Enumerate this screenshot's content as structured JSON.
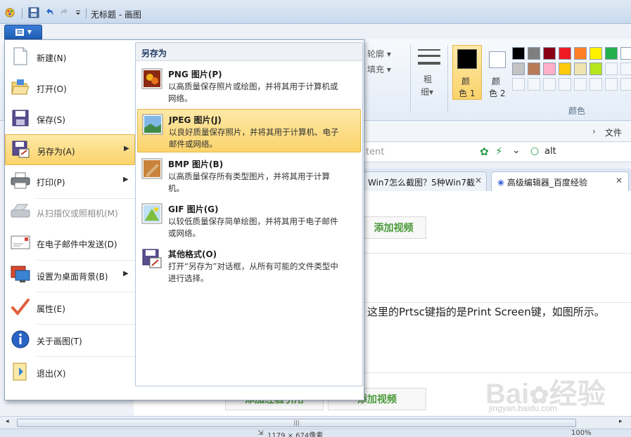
{
  "window": {
    "title": "无标题 - 画图"
  },
  "app_menu": {
    "items": [
      {
        "label": "新建(N)",
        "icon": "new-file-icon",
        "submenu": false,
        "disabled": false
      },
      {
        "label": "打开(O)",
        "icon": "open-folder-icon",
        "submenu": false,
        "disabled": false
      },
      {
        "label": "保存(S)",
        "icon": "save-disk-icon",
        "submenu": false,
        "disabled": false
      },
      {
        "label": "另存为(A)",
        "icon": "save-as-icon",
        "submenu": true,
        "disabled": false,
        "highlighted": true
      },
      {
        "label": "打印(P)",
        "icon": "printer-icon",
        "submenu": true,
        "disabled": false
      },
      {
        "label": "从扫描仪或照相机(M)",
        "icon": "scanner-icon",
        "submenu": false,
        "disabled": true
      },
      {
        "label": "在电子邮件中发送(D)",
        "icon": "email-icon",
        "submenu": false,
        "disabled": false
      },
      {
        "label": "设置为桌面背景(B)",
        "icon": "desktop-background-icon",
        "submenu": true,
        "disabled": false
      },
      {
        "label": "属性(E)",
        "icon": "checkmark-icon",
        "submenu": false,
        "disabled": false
      },
      {
        "label": "关于画图(T)",
        "icon": "info-icon",
        "submenu": false,
        "disabled": false
      },
      {
        "label": "退出(X)",
        "icon": "exit-icon",
        "submenu": false,
        "disabled": false
      }
    ],
    "save_as_submenu": {
      "header": "另存为",
      "items": [
        {
          "title": "PNG 图片(P)",
          "desc": "以高质量保存照片或绘图，并将其用于计算机或网络。",
          "icon": "png-image-icon"
        },
        {
          "title": "JPEG 图片(J)",
          "desc": "以良好质量保存照片，并将其用于计算机、电子邮件或网络。",
          "icon": "jpeg-image-icon",
          "highlighted": true
        },
        {
          "title": "BMP 图片(B)",
          "desc": "以高质量保存所有类型图片，并将其用于计算机。",
          "icon": "bmp-image-icon"
        },
        {
          "title": "GIF 图片(G)",
          "desc": "以较低质量保存简单绘图，并将其用于电子邮件或网络。",
          "icon": "gif-image-icon"
        },
        {
          "title": "其他格式(O)",
          "desc": "打开“另存为”对话框，从所有可能的文件类型中进行选择。",
          "icon": "other-format-icon"
        }
      ]
    }
  },
  "ribbon": {
    "outline_label": "轮廓",
    "fill_label": "填充",
    "size_label_1": "粗",
    "size_label_2": "细",
    "color1_label_1": "颜",
    "color1_label_2": "色 1",
    "color2_label_1": "颜",
    "color2_label_2": "色 2",
    "colors_group_label": "颜色",
    "palette": [
      "#000000",
      "#7f7f7f",
      "#880015",
      "#ed1c24",
      "#ff7f27",
      "#fff200",
      "#22b14c",
      "#ffffff",
      "#c3c3c3",
      "#b97a57",
      "#ffaec9",
      "#ffc90e",
      "#efe4b0",
      "#b5e61d"
    ]
  },
  "browser": {
    "menu_text": "文件",
    "address_fragment": "tent",
    "search_text": "alt",
    "tabs": [
      {
        "label": "Win7怎么截图？5种Win7截"
      },
      {
        "label": "高级编辑器_百度经验"
      }
    ],
    "add_video_label": "添加视频",
    "add_quote_label": "添加经验引用",
    "body_text": "这里的Prtsc键指的是Print Screen键，如图所示。"
  },
  "status": {
    "dimensions": "1179 × 674像素",
    "zoom": "100%"
  },
  "watermark": {
    "brand": "Bai",
    "brand2": "经验",
    "sub": "jingyan.baidu.com"
  }
}
